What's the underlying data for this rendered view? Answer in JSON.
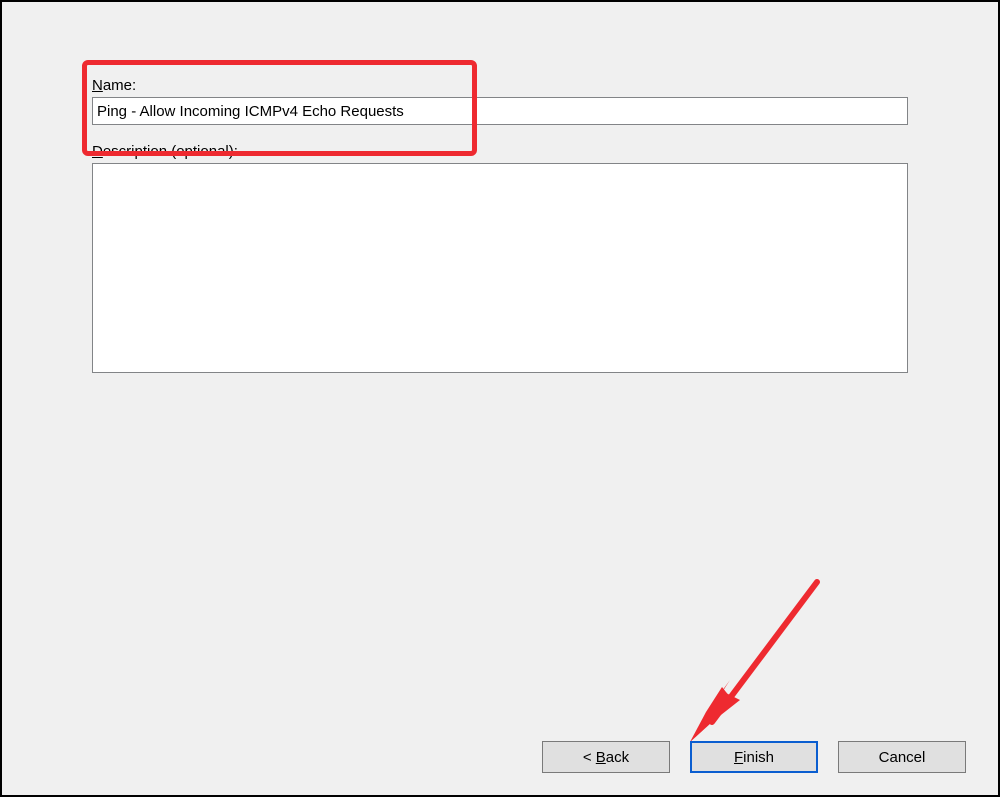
{
  "fields": {
    "name_label": "Name:",
    "name_value": "Ping - Allow Incoming ICMPv4 Echo Requests",
    "description_label": "Description (optional):",
    "description_value": ""
  },
  "buttons": {
    "back": "< Back",
    "back_letter": "B",
    "back_rest": "ack",
    "back_prefix": "< ",
    "finish": "Finish",
    "finish_letter": "F",
    "finish_rest": "inish",
    "cancel": "Cancel"
  }
}
